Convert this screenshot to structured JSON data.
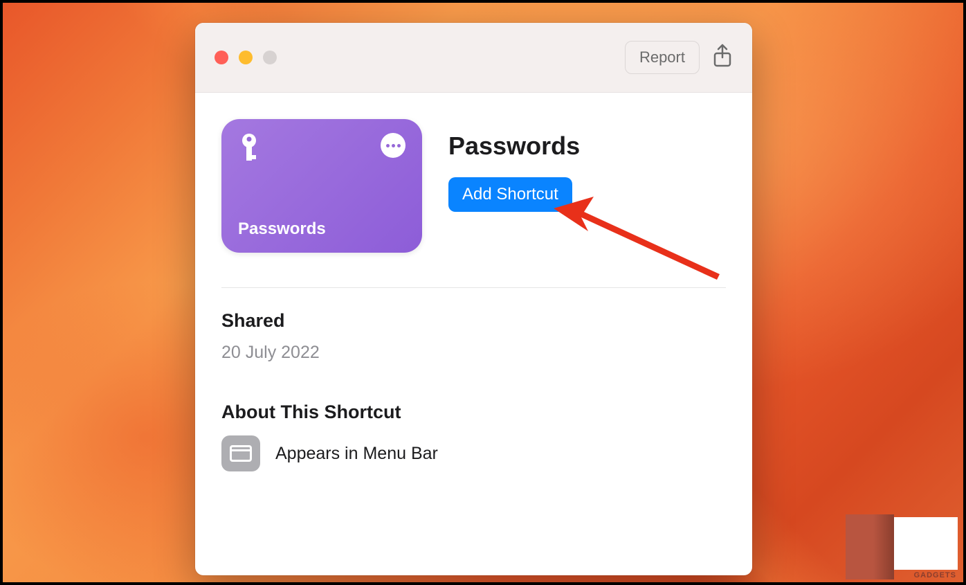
{
  "titlebar": {
    "report_label": "Report"
  },
  "shortcut": {
    "card_title": "Passwords",
    "title": "Passwords",
    "add_button_label": "Add Shortcut"
  },
  "shared": {
    "heading": "Shared",
    "date": "20 July 2022"
  },
  "about": {
    "heading": "About This Shortcut",
    "menubar_text": "Appears in Menu Bar"
  },
  "watermark": {
    "text": "GADGETS"
  }
}
